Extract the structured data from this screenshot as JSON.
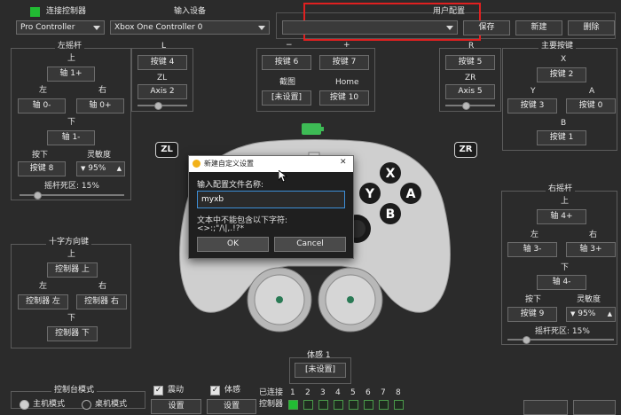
{
  "top": {
    "controller_title": "连接控制器",
    "controller_value": "Pro Controller",
    "input_title": "输入设备",
    "input_value": "Xbox One Controller 0",
    "profile_title": "用户配置",
    "profile_value": "",
    "save": "保存",
    "new": "新建",
    "delete": "删除",
    "active_color": "#22bb33",
    "highlight_color": "#e02020"
  },
  "left_stick": {
    "title": "左摇杆",
    "up_label": "上",
    "up_btn": "轴 1+",
    "left_label": "左",
    "left_btn": "轴 0-",
    "right_label": "右",
    "right_btn": "轴 0+",
    "down_label": "下",
    "down_btn": "轴 1-",
    "press_label": "按下",
    "press_btn": "按键 8",
    "sens_label": "灵敏度",
    "sens_value": "95%",
    "deadzone": "摇杆死区: 15%",
    "deadzone_pct": 15
  },
  "mid_top": {
    "l_label": "L",
    "l_btn": "按键 4",
    "zl_label": "ZL",
    "zl_btn": "Axis 2",
    "zl_level_pct": 40,
    "minus_label": "−",
    "minus_btn": "按键 6",
    "plus_label": "+",
    "plus_btn": "按键 7",
    "capture_label": "截图",
    "capture_btn": "[未设置]",
    "home_label": "Home",
    "home_btn": "按键 10",
    "r_label": "R",
    "r_btn": "按键 5",
    "zr_label": "ZR",
    "zr_btn": "Axis 5",
    "zr_level_pct": 40,
    "zl_badge": "ZL",
    "zr_badge": "ZR",
    "battery_color": "#3dbb55"
  },
  "face": {
    "title": "主要按键",
    "x_label": "X",
    "x_btn": "按键 2",
    "y_label": "Y",
    "y_btn": "按键 3",
    "a_label": "A",
    "a_btn": "按键 0",
    "b_label": "B",
    "b_btn": "按键 1"
  },
  "right_stick": {
    "title": "右摇杆",
    "up_label": "上",
    "up_btn": "轴 4+",
    "left_label": "左",
    "left_btn": "轴 3-",
    "right_label": "右",
    "right_btn": "轴 3+",
    "down_label": "下",
    "down_btn": "轴 4-",
    "press_label": "按下",
    "press_btn": "按键 9",
    "sens_label": "灵敏度",
    "sens_value": "95%",
    "deadzone": "摇杆死区: 15%",
    "deadzone_pct": 15
  },
  "dpad": {
    "title": "十字方向键",
    "up_label": "上",
    "up_btn": "控制器 上",
    "left_label": "左",
    "left_btn": "控制器 左",
    "right_label": "右",
    "right_btn": "控制器 右",
    "down_label": "下",
    "down_btn": "控制器 下"
  },
  "motion": {
    "title": "体感 1",
    "btn": "[未设置]"
  },
  "bottom": {
    "console_mode": "控制台模式",
    "mode_handheld": "主机模式",
    "mode_desktop": "桌机模式",
    "vibration": "震动",
    "motion": "体感",
    "setting": "设置",
    "connected": "已连接",
    "controller": "控制器",
    "ports": [
      "1",
      "2",
      "3",
      "4",
      "5",
      "6",
      "7",
      "8"
    ]
  },
  "controller_face": {
    "x": "X",
    "y": "Y",
    "a": "A",
    "b": "B"
  },
  "dialog": {
    "title": "新建自定义设置",
    "close": "✕",
    "prompt": "输入配置文件名称:",
    "input_value": "myxb",
    "note": "文本中不能包含以下字符:",
    "chars": "<>:;\"/\\|,.!?*",
    "ok": "OK",
    "cancel": "Cancel"
  }
}
